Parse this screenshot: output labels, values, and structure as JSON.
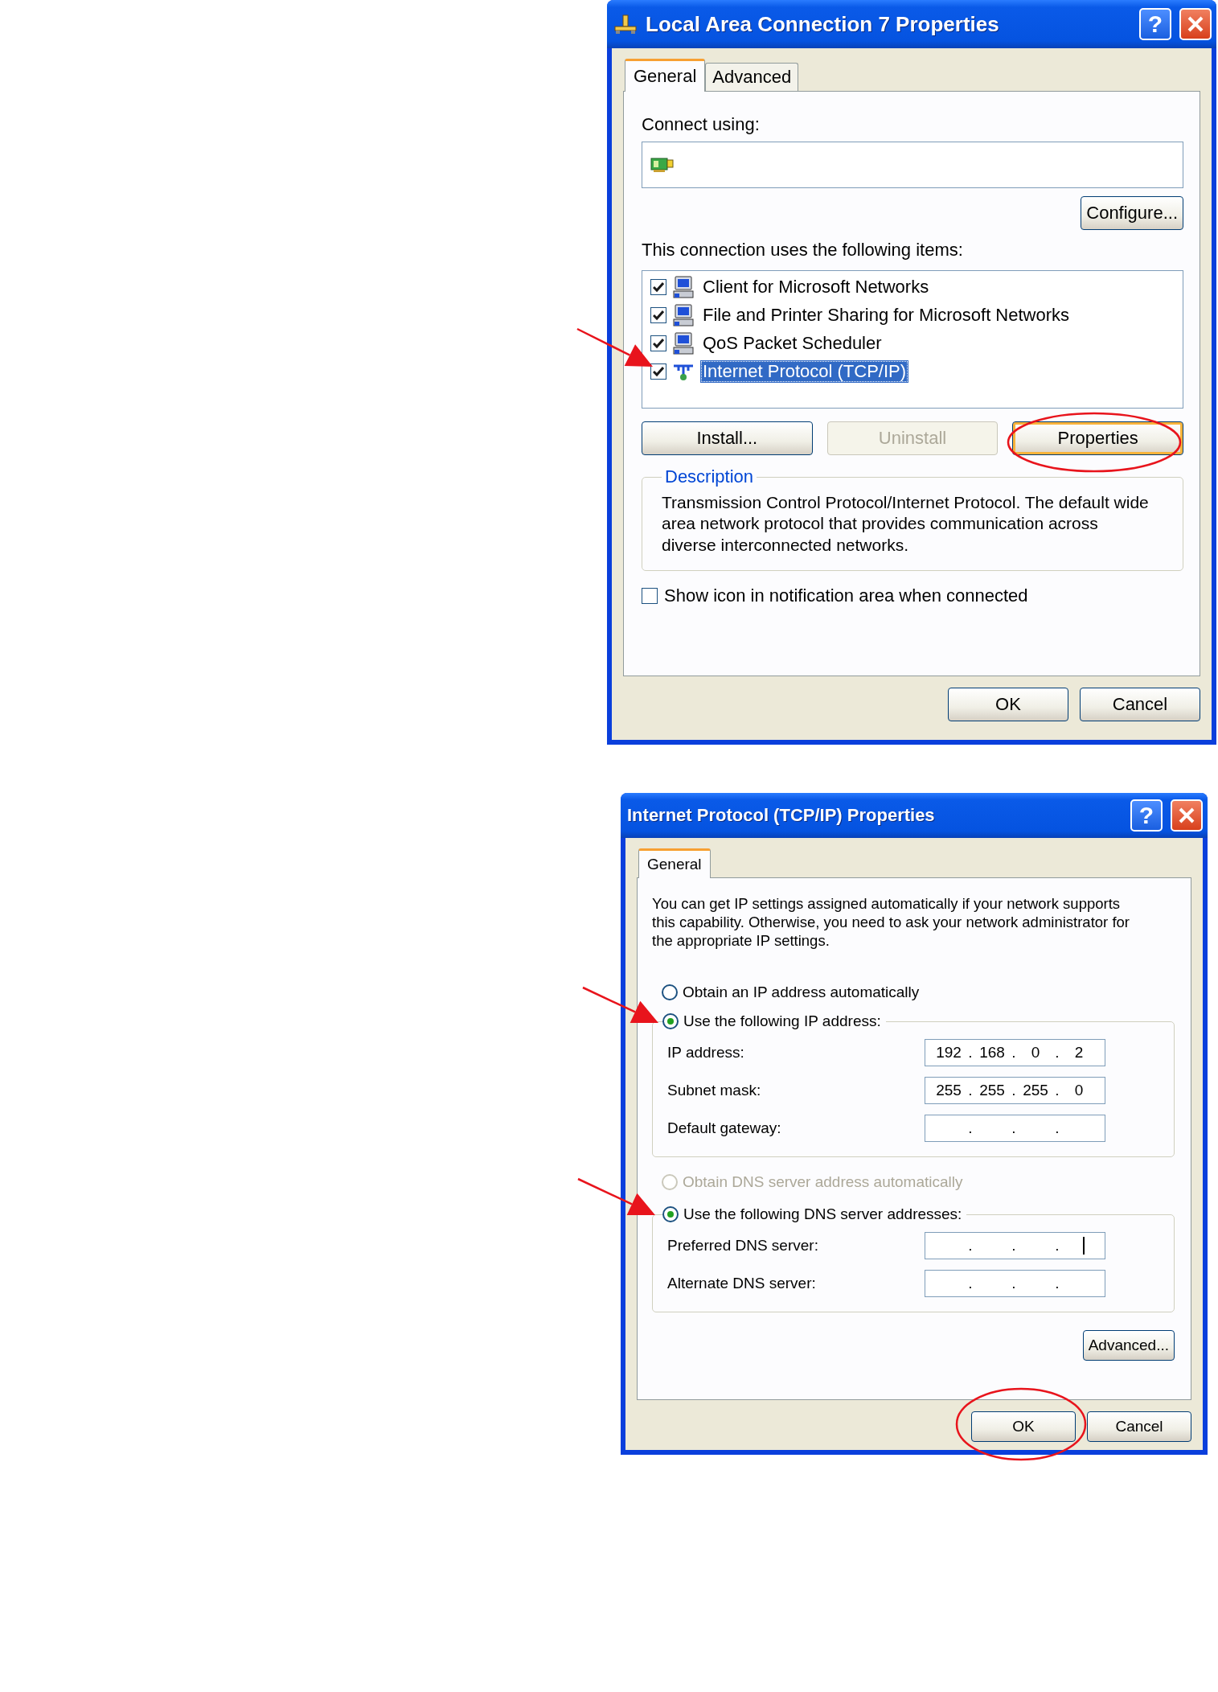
{
  "connection_dialog": {
    "title": "Local Area Connection 7 Properties",
    "help_button": "?",
    "tabs": [
      {
        "label": "General",
        "selected": true
      },
      {
        "label": "Advanced",
        "selected": false
      }
    ],
    "connect_using_label": "Connect using:",
    "configure_button": "Configure...",
    "items_label": "This connection uses the following items:",
    "items": [
      {
        "kind": "service",
        "label": "Client for Microsoft Networks",
        "checked": true,
        "selected": false
      },
      {
        "kind": "service",
        "label": "File and Printer Sharing for Microsoft Networks",
        "checked": true,
        "selected": false
      },
      {
        "kind": "service",
        "label": "QoS Packet Scheduler",
        "checked": true,
        "selected": false
      },
      {
        "kind": "protocol",
        "label": "Internet Protocol (TCP/IP)",
        "checked": true,
        "selected": true
      }
    ],
    "item_buttons": [
      {
        "label": "Install...",
        "disabled": false,
        "focused": false
      },
      {
        "label": "Uninstall",
        "disabled": true,
        "focused": false
      },
      {
        "label": "Properties",
        "disabled": false,
        "focused": true
      }
    ],
    "description": {
      "title": "Description",
      "text": "Transmission Control Protocol/Internet Protocol. The default wide area network protocol that provides communication across diverse interconnected networks."
    },
    "notification_checkbox": {
      "label": "Show icon in notification area when connected",
      "checked": false
    },
    "footer_buttons": [
      {
        "label": "OK"
      },
      {
        "label": "Cancel"
      }
    ]
  },
  "tcpip_dialog": {
    "title": "Internet Protocol (TCP/IP) Properties",
    "help_button": "?",
    "tabs": [
      {
        "label": "General",
        "selected": true
      }
    ],
    "intro": "You can get IP settings assigned automatically if your network supports this capability. Otherwise, you need to ask your network administrator for the appropriate IP settings.",
    "ip_options": [
      {
        "label": "Obtain an IP address automatically",
        "selected": false,
        "disabled": false
      },
      {
        "label": "Use the following IP address:",
        "selected": true,
        "disabled": false
      }
    ],
    "ip_fields": [
      {
        "label": "IP address:",
        "text": [
          "192",
          ".",
          "168",
          ".",
          "0",
          ".",
          "2"
        ],
        "cursor": false
      },
      {
        "label": "Subnet mask:",
        "text": [
          "255",
          ".",
          "255",
          ".",
          "255",
          ".",
          "0"
        ],
        "cursor": false
      },
      {
        "label": "Default gateway:",
        "text": [
          ".",
          ".",
          "."
        ],
        "cursor": false
      }
    ],
    "dns_options": [
      {
        "label": "Obtain DNS server address automatically",
        "selected": false,
        "disabled": true
      },
      {
        "label": "Use the following DNS server addresses:",
        "selected": true,
        "disabled": false
      }
    ],
    "dns_fields": [
      {
        "label": "Preferred DNS server:",
        "text": [
          ".",
          ".",
          "."
        ],
        "cursor": true
      },
      {
        "label": "Alternate DNS server:",
        "text": [
          ".",
          ".",
          "."
        ],
        "cursor": false
      }
    ],
    "advanced_button": "Advanced...",
    "footer_buttons": [
      {
        "label": "OK"
      },
      {
        "label": "Cancel"
      }
    ]
  }
}
